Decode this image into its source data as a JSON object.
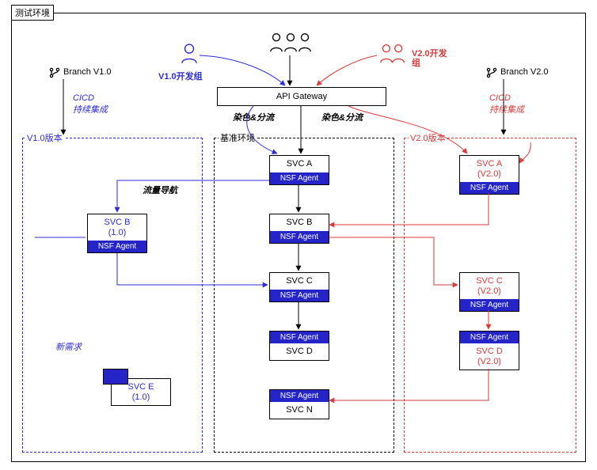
{
  "outer_title": "测试环境",
  "top": {
    "branch_left": "Branch V1.0",
    "branch_right": "Branch V2.0",
    "cicd_left": "CICD\n持续集成",
    "cicd_right": "CICD\n持续集成",
    "dev_v1": "V1.0开发组",
    "dev_v2": "V2.0开发\n组",
    "api_gateway": "API Gateway",
    "dye_left": "染色&分流",
    "dye_right": "染色&分流"
  },
  "panels": {
    "v1": "V1.0版本",
    "base": "基准环境",
    "v2": "V2.0版本"
  },
  "labels": {
    "route_override": "流量导航",
    "new_req": "新需求"
  },
  "svc": {
    "base_a": "SVC A",
    "base_b": "SVC B",
    "base_c": "SVC C",
    "base_d": "SVC D",
    "base_n": "SVC N",
    "v1_b": "SVC B\n(1.0)",
    "v1_e": "SVC E\n(1.0)",
    "v2_a": "SVC A\n(V2.0)",
    "v2_c": "SVC C\n(V2.0)",
    "v2_d": "SVC D\n(V2.0)"
  },
  "agent": "NSF Agent"
}
